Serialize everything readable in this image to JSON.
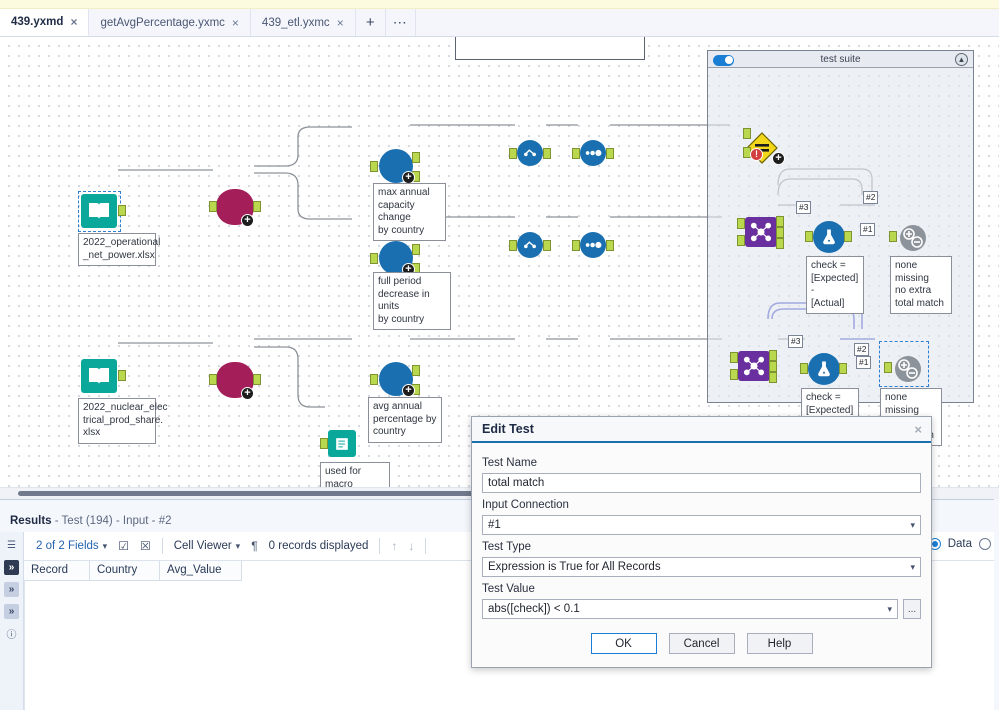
{
  "tabs": [
    {
      "label": "439.yxmd",
      "close": "×",
      "active": true
    },
    {
      "label": "getAvgPercentage.yxmc",
      "close": "×",
      "active": false
    },
    {
      "label": "439_etl.yxmc",
      "close": "×",
      "active": false
    }
  ],
  "tabbar": {
    "add_label": "+",
    "more_label": "⋯"
  },
  "canvas": {
    "annotations": [
      {
        "id": "a1",
        "text": "2022_operational\n_net_power.xlsx"
      },
      {
        "id": "a2",
        "text": "2022_nuclear_elec\ntrical_prod_share.\nxlsx"
      },
      {
        "id": "a3",
        "text": "max annual\ncapacity change\nby country"
      },
      {
        "id": "a4",
        "text": "full period\ndecrease in units\nby country"
      },
      {
        "id": "a5",
        "text": "avg annual\npercentage by\ncountry"
      },
      {
        "id": "a6",
        "text": "used for macro\ntemplate"
      },
      {
        "id": "a7",
        "text": "check =\n[Expected] -\n[Actual]"
      },
      {
        "id": "a8",
        "text": "none missing\n no extra\ntotal match"
      },
      {
        "id": "a9",
        "text": "check =\n[Expected] -\n[Actual]"
      },
      {
        "id": "a10",
        "text": "none missing\n no extra\ntotal match"
      }
    ],
    "connection_labels": {
      "c1": "#3",
      "c2": "#2",
      "c3": "#1",
      "c4": "#3",
      "c5": "#2",
      "c6": "#1"
    },
    "container": {
      "title": "test suite",
      "collapse_glyph": "▲",
      "toggle_on": true
    },
    "colors": {
      "input_tool": "#09a89b",
      "filter_tool": "#a41f5a",
      "summarize_tool": "#1a6fb0",
      "join_tool": "#6a2f9e",
      "union_tool": "#f2d71a",
      "gear_tool": "#8d939b",
      "connector": "#b9d84e",
      "highlight_wire": "#3b49c9"
    }
  },
  "results": {
    "title_label": "Results",
    "title_detail": " - Test (194) - Input - #2",
    "toolbar": {
      "fields": "2 of 2 Fields",
      "check_icon": "checkbox-icon",
      "clear_icon": "clear-icon",
      "cell_viewer": "Cell Viewer",
      "pilcrow": "¶",
      "records": "0 records displayed",
      "up_arrow": "↑",
      "down_arrow": "↓",
      "data_radio": "Data"
    },
    "columns": [
      "Record",
      "Country",
      "Avg_Value"
    ],
    "rows": [],
    "rail_icons": [
      "list-icon",
      "messages-icon",
      "messages-icon",
      "messages-icon",
      "help-icon"
    ]
  },
  "modal": {
    "title": "Edit Test",
    "close_glyph": "×",
    "fields": {
      "test_name_label": "Test Name",
      "test_name_value": "total match",
      "input_connection_label": "Input Connection",
      "input_connection_value": "#1",
      "test_type_label": "Test Type",
      "test_type_value": "Expression is True for All Records",
      "test_value_label": "Test Value",
      "test_value_value": "abs([check]) < 0.1",
      "ellipsis_label": "..."
    },
    "buttons": {
      "ok": "OK",
      "cancel": "Cancel",
      "help": "Help"
    },
    "caret_glyph": "⌄"
  }
}
